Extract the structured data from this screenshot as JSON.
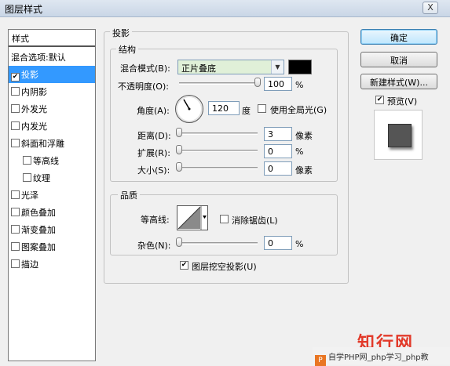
{
  "window": {
    "title": "图层样式",
    "close": "X"
  },
  "style_list": {
    "header": "样式",
    "items": [
      {
        "label": "混合选项:默认",
        "checkbox": false,
        "checked": false,
        "indent": false,
        "selected": false
      },
      {
        "label": "投影",
        "checkbox": true,
        "checked": true,
        "indent": false,
        "selected": true
      },
      {
        "label": "内阴影",
        "checkbox": true,
        "checked": false,
        "indent": false,
        "selected": false
      },
      {
        "label": "外发光",
        "checkbox": true,
        "checked": false,
        "indent": false,
        "selected": false
      },
      {
        "label": "内发光",
        "checkbox": true,
        "checked": false,
        "indent": false,
        "selected": false
      },
      {
        "label": "斜面和浮雕",
        "checkbox": true,
        "checked": false,
        "indent": false,
        "selected": false
      },
      {
        "label": "等高线",
        "checkbox": true,
        "checked": false,
        "indent": true,
        "selected": false
      },
      {
        "label": "纹理",
        "checkbox": true,
        "checked": false,
        "indent": true,
        "selected": false
      },
      {
        "label": "光泽",
        "checkbox": true,
        "checked": false,
        "indent": false,
        "selected": false
      },
      {
        "label": "颜色叠加",
        "checkbox": true,
        "checked": false,
        "indent": false,
        "selected": false
      },
      {
        "label": "渐变叠加",
        "checkbox": true,
        "checked": false,
        "indent": false,
        "selected": false
      },
      {
        "label": "图案叠加",
        "checkbox": true,
        "checked": false,
        "indent": false,
        "selected": false
      },
      {
        "label": "描边",
        "checkbox": true,
        "checked": false,
        "indent": false,
        "selected": false
      }
    ]
  },
  "drop_shadow": {
    "title": "投影",
    "structure": {
      "title": "结构",
      "blend_mode_label": "混合模式(B):",
      "blend_mode_value": "正片叠底",
      "shadow_color": "#000000",
      "opacity_label": "不透明度(O):",
      "opacity_value": "100",
      "opacity_fraction": 1.0,
      "percent": "%",
      "angle_label": "角度(A):",
      "angle_value": "120",
      "degree": "度",
      "global_light_label": "使用全局光(G)",
      "global_light_checked": false,
      "distance_label": "距离(D):",
      "distance_value": "3",
      "distance_fraction": 0.0,
      "pixels": "像素",
      "spread_label": "扩展(R):",
      "spread_value": "0",
      "spread_fraction": 0.0,
      "size_label": "大小(S):",
      "size_value": "0",
      "size_fraction": 0.0
    },
    "quality": {
      "title": "品质",
      "contour_label": "等高线:",
      "anti_alias_label": "消除锯齿(L)",
      "anti_alias_checked": false,
      "noise_label": "杂色(N):",
      "noise_value": "0",
      "noise_fraction": 0.0
    },
    "knockout_label": "图层挖空投影(U)",
    "knockout_checked": true
  },
  "buttons": {
    "ok": "确定",
    "cancel": "取消",
    "new_style": "新建样式(W)...",
    "preview_label": "预览(V)",
    "preview_checked": true
  },
  "watermark": {
    "brand": "知行网",
    "site_text": "自学PHP网_php学习_php教",
    "logo_letter": "P"
  }
}
